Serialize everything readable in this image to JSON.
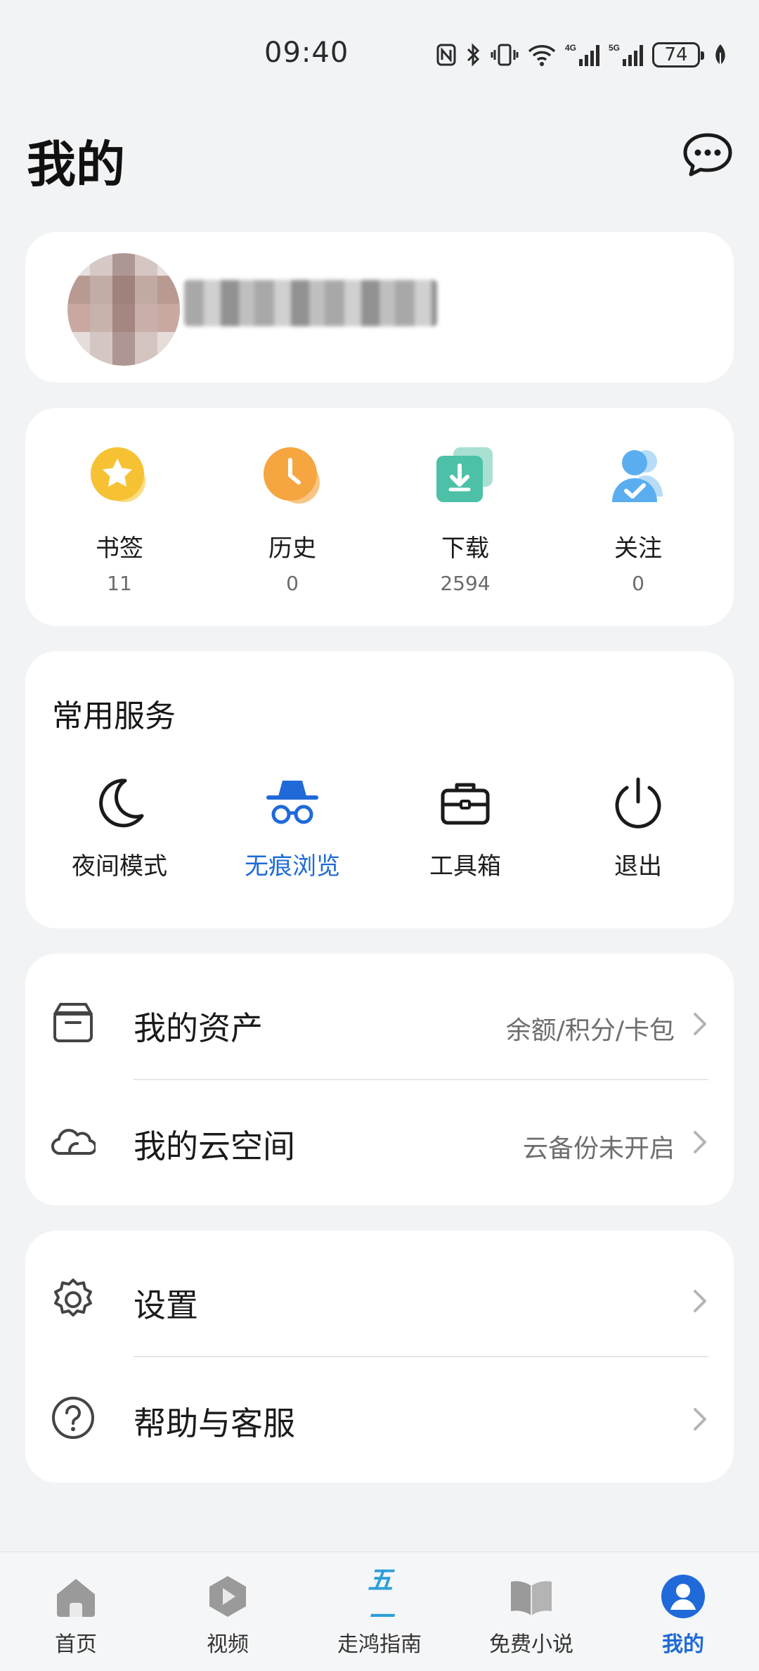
{
  "status_bar": {
    "time": "09:40",
    "battery": "74",
    "icons": [
      "nfc-icon",
      "bluetooth-icon",
      "vibrate-icon",
      "wifi-icon",
      "4g-signal-icon",
      "5g-signal-icon",
      "battery-icon",
      "leaf-icon"
    ],
    "network_labels": [
      "4G",
      "5G"
    ]
  },
  "header": {
    "title": "我的",
    "message_icon": "chat-bubble-icon"
  },
  "profile": {
    "avatar_icon": "avatar-blurred",
    "username": ""
  },
  "stats": [
    {
      "label": "书签",
      "count": "11",
      "icon": "bookmark-star-icon",
      "color": "#f6c233"
    },
    {
      "label": "历史",
      "count": "0",
      "icon": "history-clock-icon",
      "color": "#f5a640"
    },
    {
      "label": "下载",
      "count": "2594",
      "icon": "download-icon",
      "color": "#4cc1a7"
    },
    {
      "label": "关注",
      "count": "0",
      "icon": "follow-person-icon",
      "color": "#5aaef0"
    }
  ],
  "services": {
    "title": "常用服务",
    "items": [
      {
        "label": "夜间模式",
        "icon": "moon-icon"
      },
      {
        "label": "无痕浏览",
        "icon": "incognito-icon",
        "active": true
      },
      {
        "label": "工具箱",
        "icon": "toolbox-icon"
      },
      {
        "label": "退出",
        "icon": "power-icon"
      }
    ]
  },
  "list1": [
    {
      "label": "我的资产",
      "subtitle": "余额/积分/卡包",
      "icon": "wallet-box-icon"
    },
    {
      "label": "我的云空间",
      "subtitle": "云备份未开启",
      "icon": "cloud-icon"
    }
  ],
  "list2": [
    {
      "label": "设置",
      "subtitle": "",
      "icon": "gear-icon"
    },
    {
      "label": "帮助与客服",
      "subtitle": "",
      "icon": "help-circle-icon"
    }
  ],
  "bottom_nav": [
    {
      "label": "首页",
      "icon": "home-icon"
    },
    {
      "label": "视频",
      "icon": "video-play-icon"
    },
    {
      "label": "走鸿指南",
      "icon": "wuyi-logo-icon",
      "logo_text": "五一"
    },
    {
      "label": "免费小说",
      "icon": "book-icon"
    },
    {
      "label": "我的",
      "icon": "profile-icon",
      "active": true
    }
  ],
  "colors": {
    "accent": "#1f6ad8",
    "background": "#f1f3f5",
    "card": "#ffffff"
  }
}
